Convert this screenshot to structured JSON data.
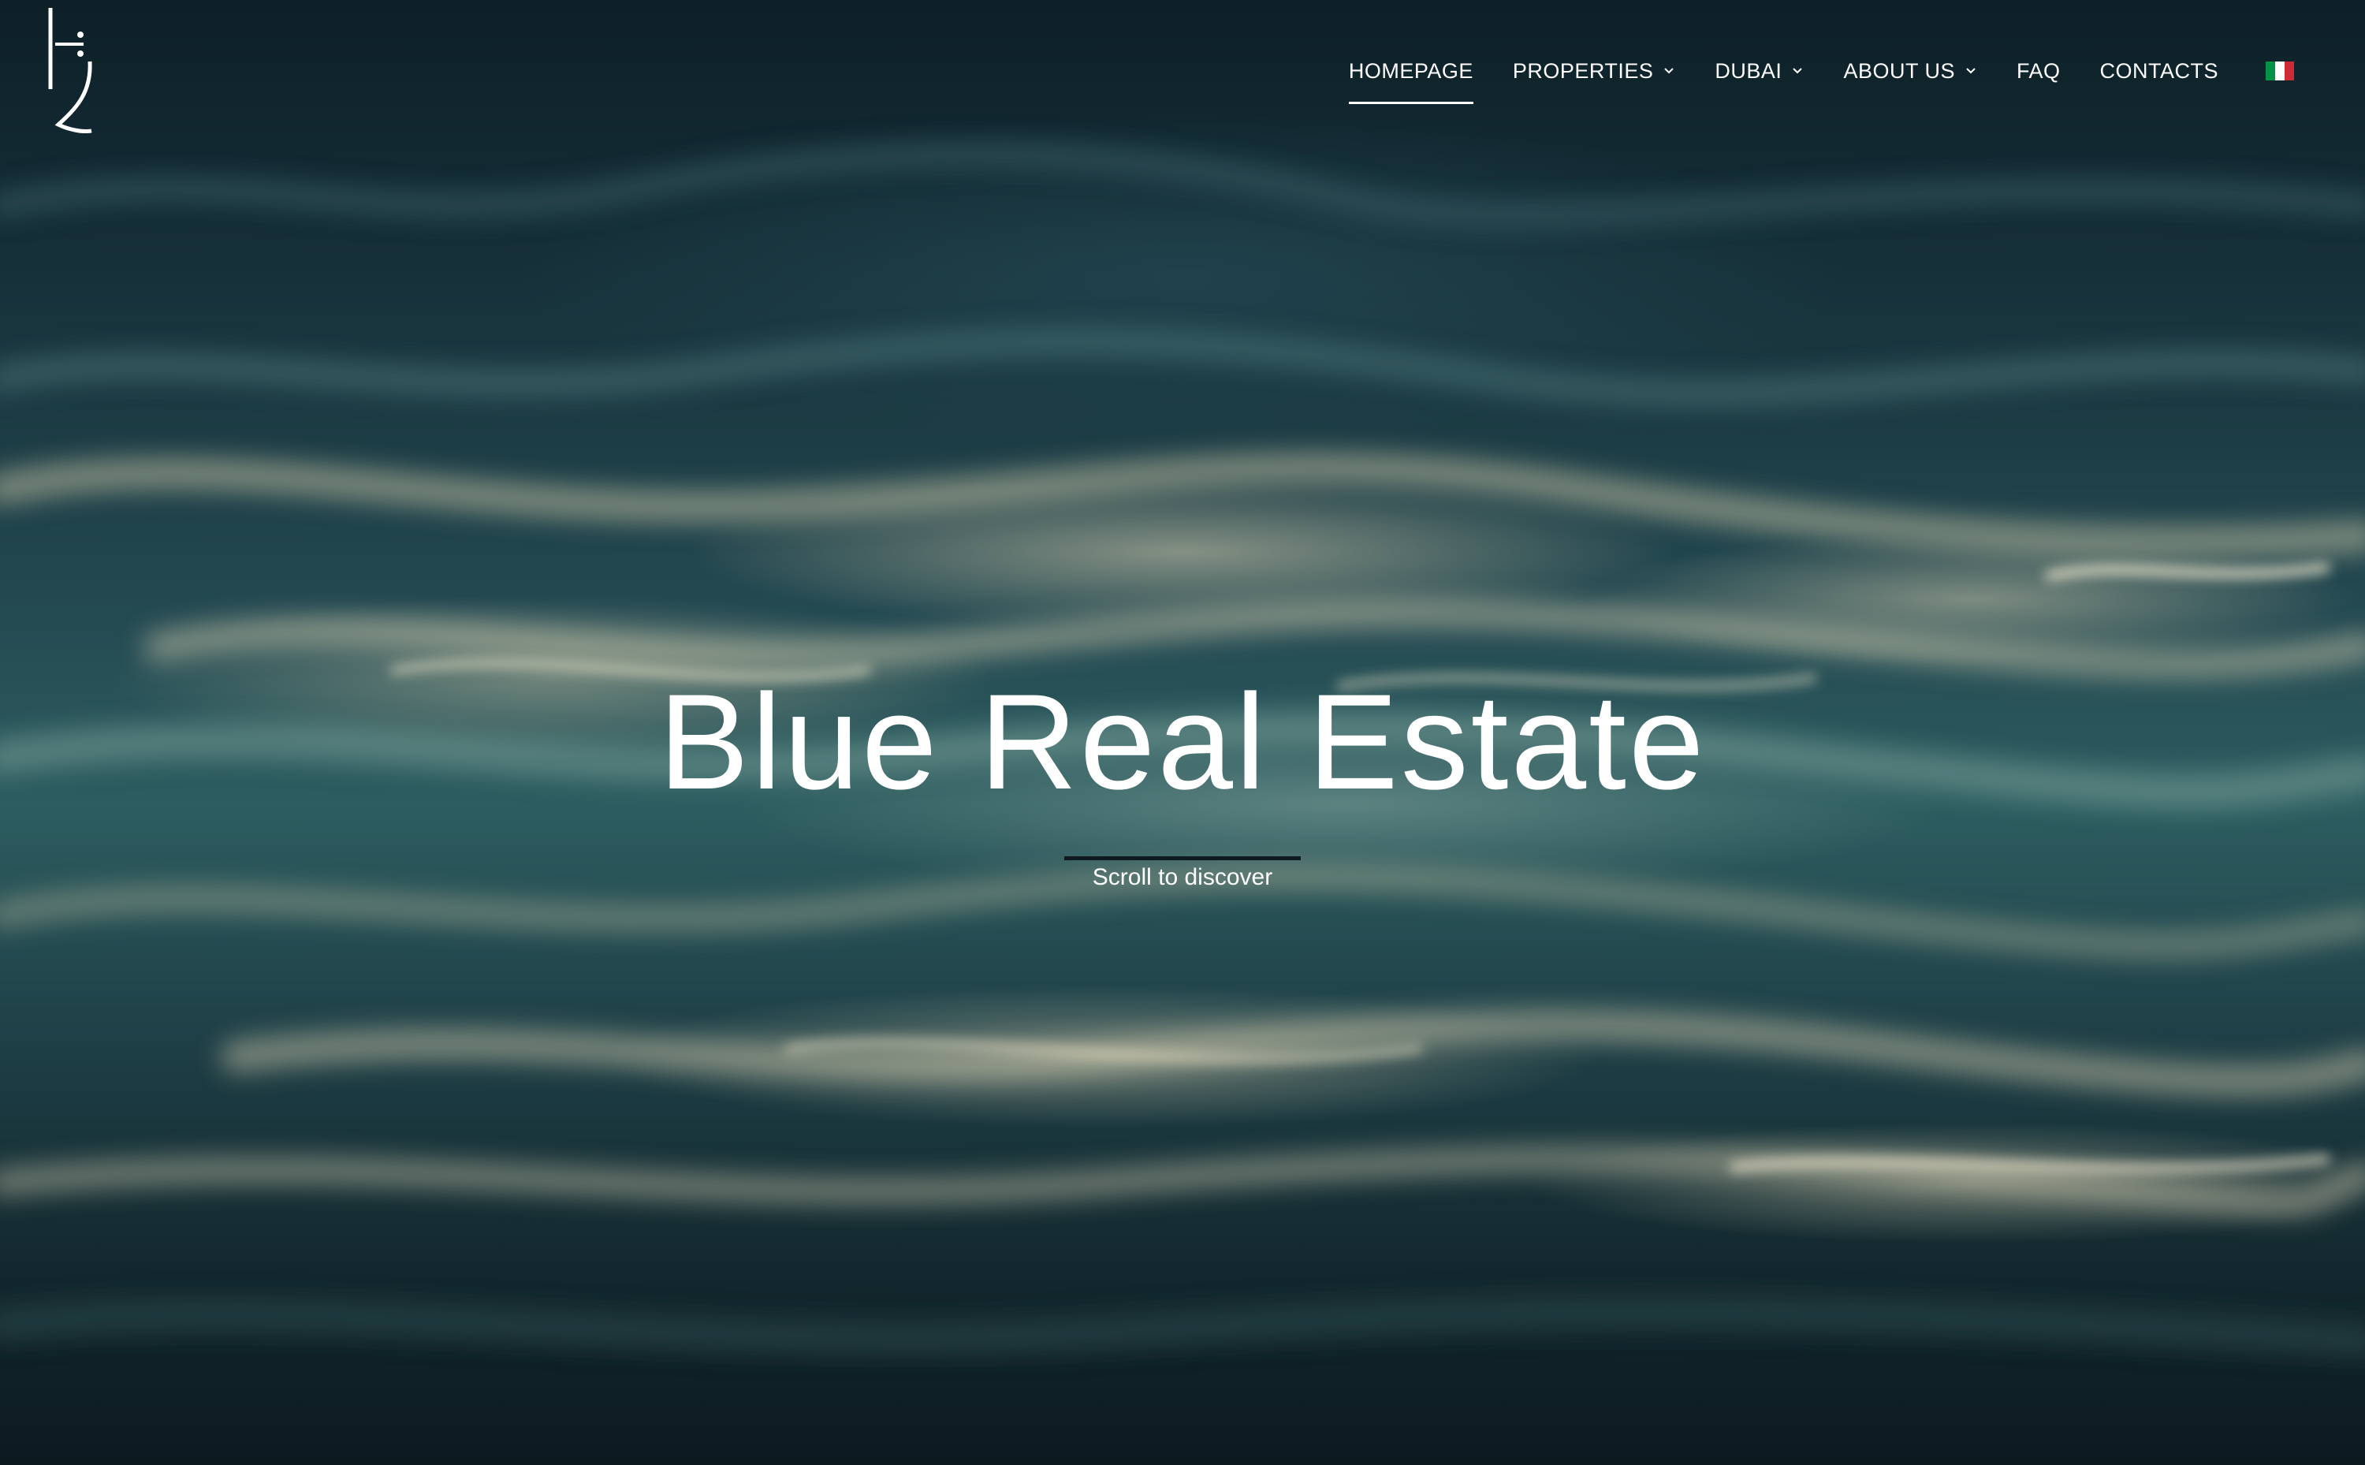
{
  "header": {
    "logo_icon": "brand-monogram-icon",
    "nav": [
      {
        "label": "HOMEPAGE",
        "active": true,
        "has_dropdown": false
      },
      {
        "label": "PROPERTIES",
        "active": false,
        "has_dropdown": true
      },
      {
        "label": "DUBAI",
        "active": false,
        "has_dropdown": true
      },
      {
        "label": "ABOUT US",
        "active": false,
        "has_dropdown": true
      },
      {
        "label": "FAQ",
        "active": false,
        "has_dropdown": false
      },
      {
        "label": "CONTACTS",
        "active": false,
        "has_dropdown": false
      }
    ],
    "language_flag": {
      "icon": "italian-flag-icon",
      "colors": [
        "#009246",
        "#ffffff",
        "#ce2b37"
      ]
    }
  },
  "hero": {
    "title": "Blue Real Estate",
    "scroll_label": "Scroll to discover",
    "background": "dark teal water surface with golden highlights"
  },
  "colors": {
    "text": "#ffffff",
    "background_dark": "#0d1f27",
    "background_mid": "#2d5d60",
    "highlight": "#d6ceb0"
  }
}
